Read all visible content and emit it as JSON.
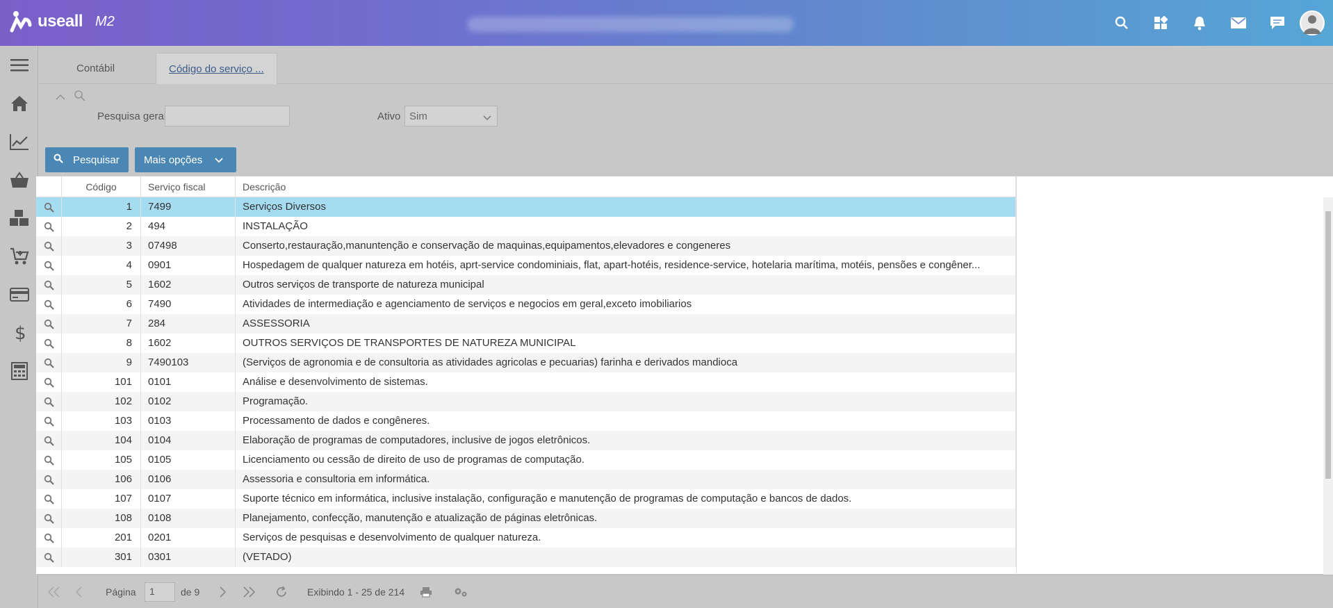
{
  "app": {
    "brand": "useall",
    "version": "M2",
    "accent": "#4a87b5",
    "header_icons": [
      "search-icon",
      "apps-icon",
      "bell-icon",
      "mail-icon",
      "chat-icon"
    ]
  },
  "sidebar": {
    "items": [
      "menu-icon",
      "home-icon",
      "chart-icon",
      "basket-icon",
      "boxes-icon",
      "cart-icon",
      "card-icon",
      "dollar-icon",
      "calculator-icon"
    ]
  },
  "tabs": [
    {
      "label": "Contábil"
    },
    {
      "label": "Código do serviço ..."
    }
  ],
  "filters": {
    "search_label": "Pesquisa geral",
    "search_value": "",
    "active_label": "Ativo",
    "active_value": "Sim"
  },
  "actions": {
    "search_button": "Pesquisar",
    "more_button": "Mais opções"
  },
  "grid": {
    "columns": [
      "Código",
      "Serviço fiscal",
      "Descrição"
    ],
    "rows": [
      [
        "1",
        "7499",
        "Serviços Diversos"
      ],
      [
        "2",
        "494",
        "INSTALAÇÃO"
      ],
      [
        "3",
        "07498",
        "Conserto,restauração,manuntenção e conservação de maquinas,equipamentos,elevadores e congeneres"
      ],
      [
        "4",
        "0901",
        "Hospedagem de qualquer natureza em hotéis, aprt-service condominiais, flat, apart-hotéis, residence-service, hotelaria marítima, motéis, pensões e congêner..."
      ],
      [
        "5",
        "1602",
        "Outros serviços de transporte de natureza municipal"
      ],
      [
        "6",
        "7490",
        "Atividades de intermediação e agenciamento de serviços e negocios em geral,exceto imobiliarios"
      ],
      [
        "7",
        "284",
        "ASSESSORIA"
      ],
      [
        "8",
        "1602",
        "OUTROS SERVIÇOS DE TRANSPORTES DE NATUREZA MUNICIPAL"
      ],
      [
        "9",
        "7490103",
        "(Serviços de agronomia e de consultoria as atividades agricolas e pecuarias) farinha e derivados mandioca"
      ],
      [
        "101",
        "0101",
        "Análise e desenvolvimento de sistemas."
      ],
      [
        "102",
        "0102",
        "Programação."
      ],
      [
        "103",
        "0103",
        "Processamento de dados e congêneres."
      ],
      [
        "104",
        "0104",
        "Elaboração de programas de computadores, inclusive de jogos eletrônicos."
      ],
      [
        "105",
        "0105",
        "Licenciamento ou cessão de direito de uso de programas de computação."
      ],
      [
        "106",
        "0106",
        "Assessoria e consultoria em informática."
      ],
      [
        "107",
        "0107",
        "Suporte técnico em informática, inclusive instalação, configuração e manutenção de programas de computação e bancos de dados."
      ],
      [
        "108",
        "0108",
        "Planejamento, confecção, manutenção e atualização de páginas eletrônicas."
      ],
      [
        "201",
        "0201",
        "Serviços de pesquisas e desenvolvimento de qualquer natureza."
      ],
      [
        "301",
        "0301",
        "(VETADO)"
      ]
    ]
  },
  "pager": {
    "page_label": "Página",
    "page_value": "1",
    "of_label": "de 9",
    "summary": "Exibindo 1 - 25 de 214"
  }
}
